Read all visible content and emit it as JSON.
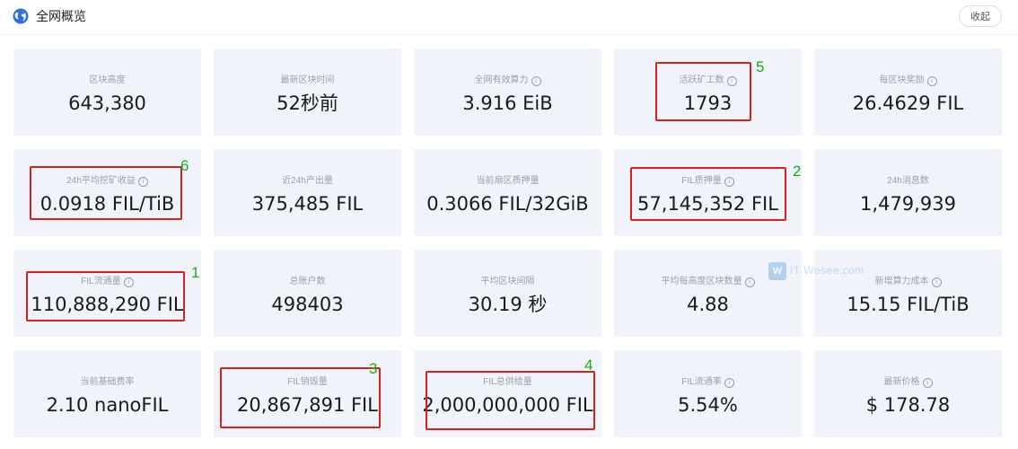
{
  "header": {
    "title": "全网概览",
    "collapse_label": "收起",
    "icon": "globe-icon"
  },
  "cards": [
    {
      "label": "区块高度",
      "value": "643,380",
      "info": false
    },
    {
      "label": "最新区块时间",
      "value": "52秒前",
      "info": false
    },
    {
      "label": "全网有效算力",
      "value": "3.916 EiB",
      "info": true
    },
    {
      "label": "活跃矿工数",
      "value": "1793",
      "info": true
    },
    {
      "label": "每区块奖励",
      "value": "26.4629 FIL",
      "info": true
    },
    {
      "label": "24h平均挖矿收益",
      "value": "0.0918 FIL/TiB",
      "info": true
    },
    {
      "label": "近24h产出量",
      "value": "375,485 FIL",
      "info": false
    },
    {
      "label": "当前扇区质押量",
      "value": "0.3066 FIL/32GiB",
      "info": false
    },
    {
      "label": "FIL质押量",
      "value": "57,145,352 FIL",
      "info": true
    },
    {
      "label": "24h消息数",
      "value": "1,479,939",
      "info": false
    },
    {
      "label": "FIL流通量",
      "value": "110,888,290 FIL",
      "info": true
    },
    {
      "label": "总账户数",
      "value": "498403",
      "info": false
    },
    {
      "label": "平均区块间隔",
      "value": "30.19 秒",
      "info": false
    },
    {
      "label": "平均每高度区块数量",
      "value": "4.88",
      "info": true
    },
    {
      "label": "新增算力成本",
      "value": "15.15 FIL/TiB",
      "info": true
    },
    {
      "label": "当前基础费率",
      "value": "2.10 nanoFIL",
      "info": false
    },
    {
      "label": "FIL销毁量",
      "value": "20,867,891 FIL",
      "info": false
    },
    {
      "label": "FIL总供给量",
      "value": "2,000,000,000 FIL",
      "info": false
    },
    {
      "label": "FIL流通率",
      "value": "5.54%",
      "info": true
    },
    {
      "label": "最新价格",
      "value": "$ 178.78",
      "info": true
    }
  ],
  "annotations": [
    {
      "number": "5",
      "card": 3
    },
    {
      "number": "6",
      "card": 5
    },
    {
      "number": "2",
      "card": 8
    },
    {
      "number": "1",
      "card": 10
    },
    {
      "number": "3",
      "card": 16
    },
    {
      "number": "4",
      "card": 17
    }
  ],
  "watermark": {
    "badge": "W",
    "text": "IT Wesee.com"
  },
  "colors": {
    "card_bg": "#f0f3f9",
    "highlight": "#d9211c",
    "annotation_number": "#13b213",
    "label_text": "#9aa0ab",
    "value_text": "#1a1a1a"
  }
}
